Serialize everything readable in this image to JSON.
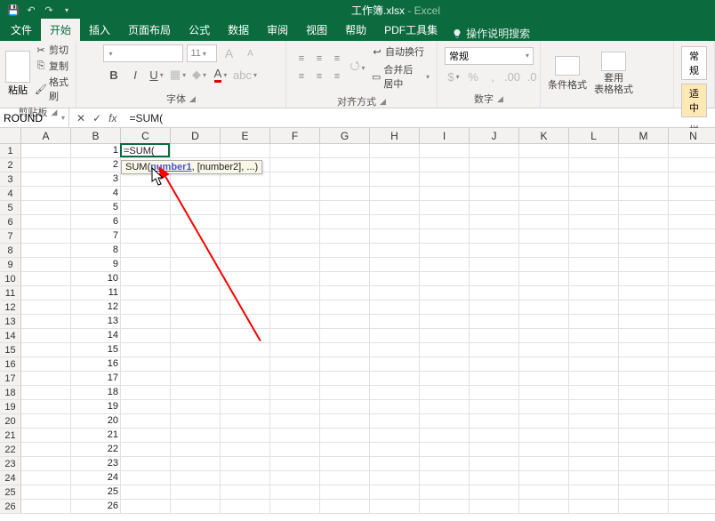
{
  "title": {
    "doc": "工作簿.xlsx",
    "app": "Excel",
    "sep": " - "
  },
  "qat": {
    "save": "save-icon",
    "undo": "undo-icon",
    "redo": "redo-icon"
  },
  "tabs": {
    "file": "文件",
    "home": "开始",
    "insert": "插入",
    "layout": "页面布局",
    "formulas": "公式",
    "data": "数据",
    "review": "审阅",
    "view": "视图",
    "help": "帮助",
    "pdf": "PDF工具集",
    "tellme": "操作说明搜索"
  },
  "ribbon": {
    "clipboard": {
      "label": "剪贴板",
      "paste": "粘贴",
      "cut": "剪切",
      "copy": "复制",
      "fmt": "格式刷"
    },
    "font": {
      "label": "字体",
      "name_placeholder": "",
      "size": "11",
      "grow": "A",
      "shrink": "A",
      "bold": "B",
      "italic": "I",
      "underline": "U"
    },
    "align": {
      "label": "对齐方式",
      "wrap": "自动换行",
      "merge": "合并后居中"
    },
    "number": {
      "label": "数字",
      "format": "常规",
      "pct": "%",
      "comma": ",",
      "inc": "←0.0",
      "dec": "0.0→"
    },
    "styles": {
      "cond": "条件格式",
      "table": "套用\n表格格式",
      "cell": "常规",
      "note": "适中",
      "label": "样"
    }
  },
  "fx": {
    "name": "ROUND",
    "cancel": "✕",
    "enter": "✓",
    "fx": "fx",
    "formula": "=SUM("
  },
  "grid": {
    "cols": [
      "A",
      "B",
      "C",
      "D",
      "E",
      "F",
      "G",
      "H",
      "I",
      "J",
      "K",
      "L",
      "M",
      "N"
    ],
    "rows": 26,
    "colB": [
      1,
      2,
      3,
      4,
      5,
      6,
      7,
      8,
      9,
      10,
      11,
      12,
      13,
      14,
      15,
      16,
      17,
      18,
      19,
      20,
      21,
      22,
      23,
      24,
      25,
      26
    ],
    "editing": {
      "text": "=SUM("
    },
    "tooltip": {
      "prefix": "SUM(",
      "arg1": "number1",
      "rest": ", [number2], ...)"
    }
  }
}
